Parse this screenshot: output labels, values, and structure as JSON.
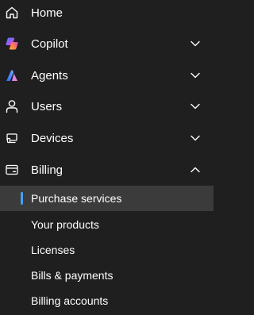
{
  "nav": {
    "items": [
      {
        "label": "Home",
        "icon": "home-icon"
      },
      {
        "label": "Copilot",
        "icon": "copilot-icon",
        "expanded": false
      },
      {
        "label": "Agents",
        "icon": "agents-icon",
        "expanded": false
      },
      {
        "label": "Users",
        "icon": "user-icon",
        "expanded": false
      },
      {
        "label": "Devices",
        "icon": "devices-icon",
        "expanded": false
      },
      {
        "label": "Billing",
        "icon": "billing-card-icon",
        "expanded": true
      }
    ],
    "billing_subitems": [
      {
        "label": "Purchase services",
        "selected": true
      },
      {
        "label": "Your products"
      },
      {
        "label": "Licenses"
      },
      {
        "label": "Bills & payments"
      },
      {
        "label": "Billing accounts"
      }
    ]
  },
  "colors": {
    "background": "#1f1f1f",
    "selected_background": "#3b3b3b",
    "accent": "#479ef5",
    "text": "#ffffff"
  }
}
